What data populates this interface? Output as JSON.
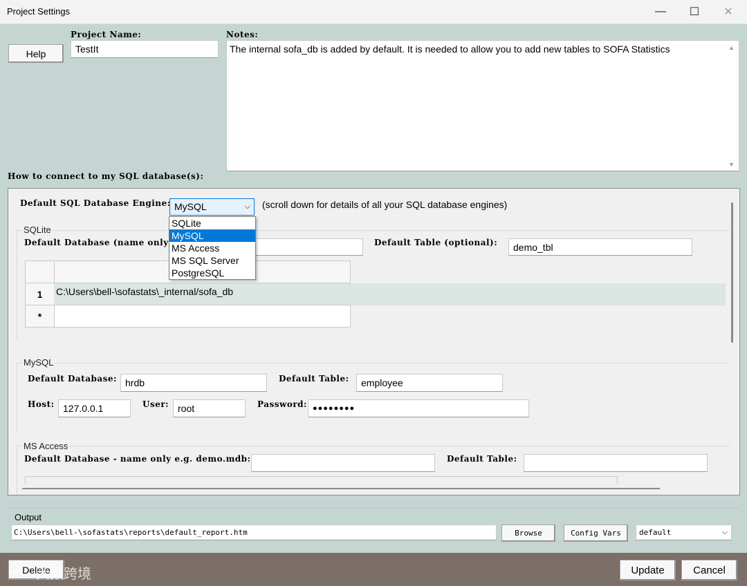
{
  "window": {
    "title": "Project Settings",
    "minimize": "—",
    "maximize": "☐",
    "close": "✕"
  },
  "header": {
    "help_label": "Help",
    "project_name_label": "Project Name:",
    "project_name_value": "TestIt",
    "notes_label": "Notes:",
    "notes_value": "The internal sofa_db is added by default. It is needed to allow you to add new tables to SOFA Statistics",
    "connect_label": "How to connect to my SQL database(s):"
  },
  "engine": {
    "label": "Default SQL Database Engine:",
    "selected": "MySQL",
    "hint": "(scroll down for details of all your SQL database engines)",
    "options": [
      "SQLite",
      "MySQL",
      "MS Access",
      "MS SQL Server",
      "PostgreSQL"
    ],
    "selected_index": 1
  },
  "sqlite": {
    "group_title": "SQLite",
    "default_db_label": "Default Database (name only):",
    "default_table_label": "Default Table (optional):",
    "default_table_value": "demo_tbl",
    "rows": [
      {
        "num": "1",
        "path": "C:\\Users\\bell-\\sofastats\\_internal/sofa_db"
      },
      {
        "num": "*",
        "path": ""
      }
    ]
  },
  "mysql": {
    "group_title": "MySQL",
    "default_db_label": "Default Database:",
    "default_db_value": "hrdb",
    "default_table_label": "Default Table:",
    "default_table_value": "employee",
    "host_label": "Host:",
    "host_value": "127.0.0.1",
    "user_label": "User:",
    "user_value": "root",
    "password_label": "Password:",
    "password_value": "●●●●●●●●"
  },
  "msaccess": {
    "group_title": "MS Access",
    "default_db_label": "Default Database - name only e.g. demo.mdb:",
    "default_db_value": "",
    "default_table_label": "Default Table:",
    "default_table_value": ""
  },
  "output": {
    "label": "Output",
    "path": "C:\\Users\\bell-\\sofastats\\reports\\default_report.htm",
    "browse_label": "Browse",
    "config_vars_label": "Config Vars",
    "style_value": "default"
  },
  "footer": {
    "delete_label": "Delete",
    "update_label": "Update",
    "cancel_label": "Cancel",
    "watermark": "大数跨境"
  }
}
